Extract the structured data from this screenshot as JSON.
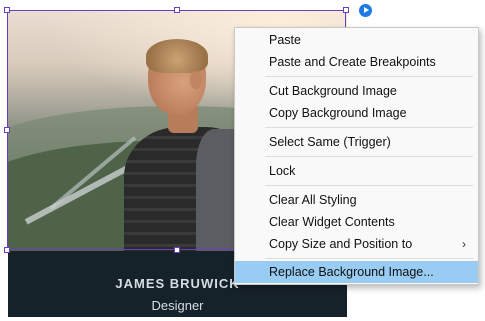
{
  "card": {
    "name": "JAMES BRUWICK",
    "role": "Designer"
  },
  "context_menu": {
    "items": [
      {
        "label": "Paste"
      },
      {
        "label": "Paste and Create Breakpoints"
      },
      {
        "label": "Cut Background Image"
      },
      {
        "label": "Copy Background Image"
      },
      {
        "label": "Select Same (Trigger)"
      },
      {
        "label": "Lock"
      },
      {
        "label": "Clear All Styling"
      },
      {
        "label": "Clear Widget Contents"
      },
      {
        "label": "Copy Size and Position to",
        "submenu": true
      },
      {
        "label": "Replace Background Image...",
        "highlighted": true
      }
    ],
    "submenu_arrow": "›"
  },
  "icons": {
    "play": "play-icon"
  },
  "colors": {
    "selection": "#6a3fbf",
    "highlight": "#99ccf2",
    "namebar": "#16222a"
  }
}
